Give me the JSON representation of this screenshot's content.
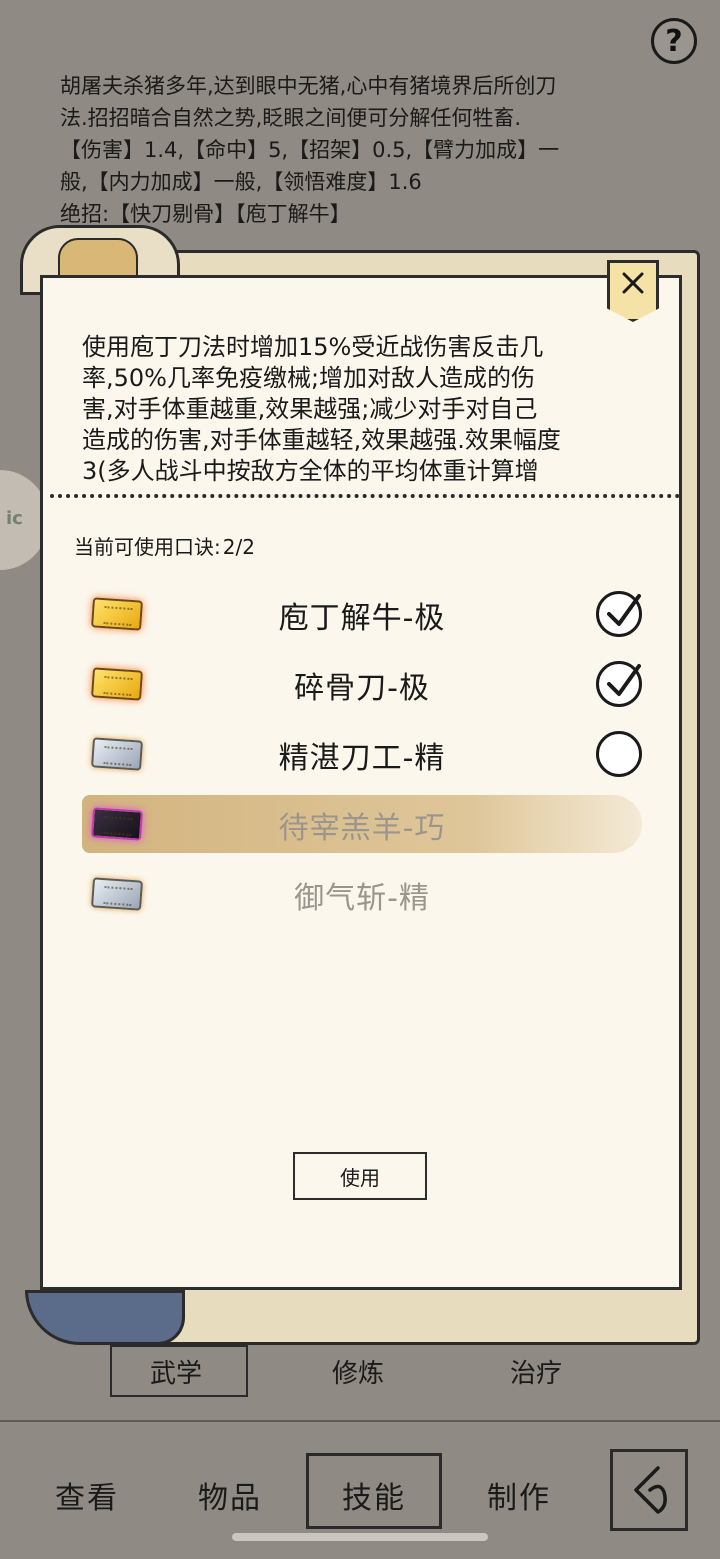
{
  "help": {
    "label": "?"
  },
  "skill_description": {
    "lines": [
      "胡屠夫杀猪多年,达到眼中无猪,心中有猪境界后所创刀",
      "法.招招暗合自然之势,眨眼之间便可分解任何牲畜.",
      "【伤害】1.4,【命中】5,【招架】0.5,【臂力加成】一",
      "般,【内力加成】一般,【领悟难度】1.6",
      "绝招:【快刀剔骨】【庖丁解牛】"
    ]
  },
  "dialog": {
    "close_icon": "close-icon",
    "effect_lines": [
      "使用庖丁刀法时增加15%受近战伤害反击几",
      "率,50%几率免疫缴械;增加对敌人造成的伤",
      "害,对手体重越重,效果越强;减少对手对自己",
      "造成的伤害,对手体重越轻,效果越强.效果幅度",
      "3(多人战斗中按敌方全体的平均体重计算增"
    ],
    "counter_label": "当前可使用口诀:",
    "counter_value": "2/2",
    "mantras": [
      {
        "name": "庖丁解牛-极",
        "tier": "gold",
        "state": "checked"
      },
      {
        "name": "碎骨刀-极",
        "tier": "gold",
        "state": "checked"
      },
      {
        "name": "精湛刀工-精",
        "tier": "silver",
        "state": "unchecked"
      },
      {
        "name": "待宰羔羊-巧",
        "tier": "purple",
        "state": "disabled-highlighted"
      },
      {
        "name": "御气斩-精",
        "tier": "silver",
        "state": "disabled"
      }
    ],
    "use_button": "使用"
  },
  "side_tab": {
    "label": "ic"
  },
  "sub_tabs": [
    "武学",
    "修炼",
    "治疗"
  ],
  "nav": {
    "items": [
      "查看",
      "物品",
      "技能",
      "制作"
    ],
    "active": "技能",
    "back_icon": "back-arrow-icon"
  }
}
